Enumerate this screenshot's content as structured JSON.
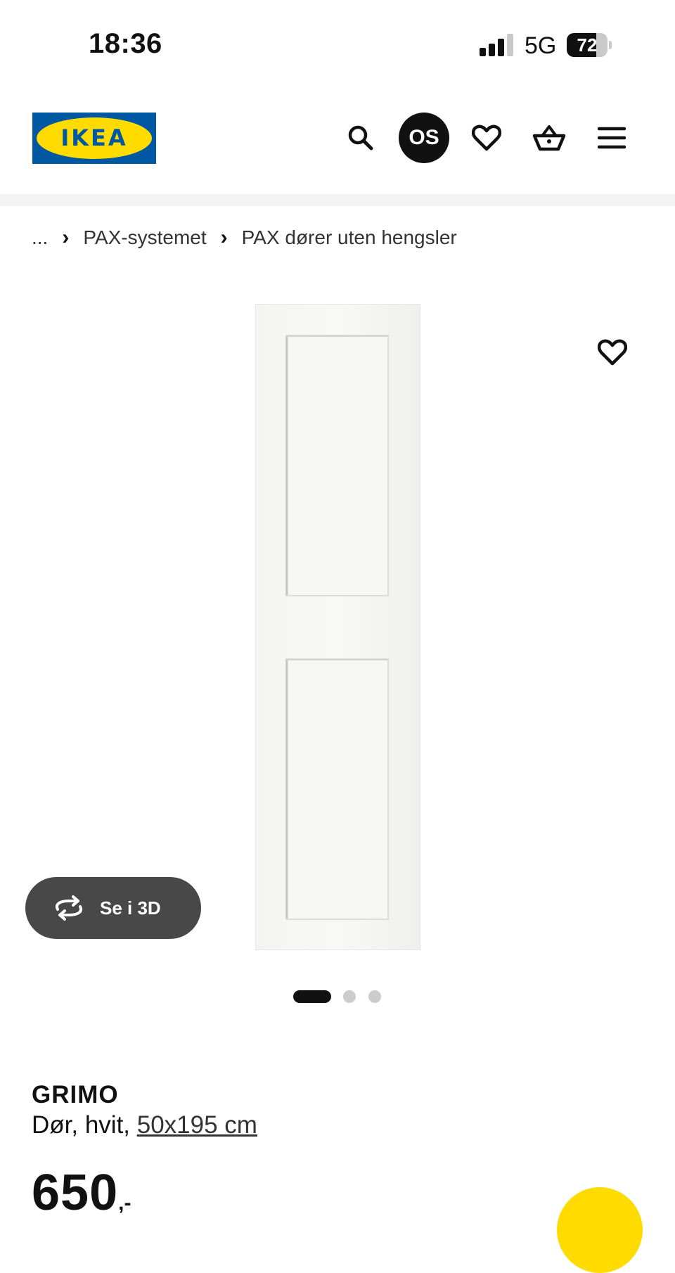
{
  "status_bar": {
    "time": "18:36",
    "network": "5G",
    "battery_level": "72",
    "battery_fraction": 0.72,
    "signal_bars_active": 3,
    "signal_bars_total": 4
  },
  "header": {
    "logo_text": "IKEA",
    "avatar_initials": "OS",
    "icons": [
      "search-icon",
      "heart-icon",
      "basket-icon",
      "menu-icon"
    ],
    "brand_colors": {
      "blue": "#0058a3",
      "yellow": "#ffdb00"
    }
  },
  "breadcrumb": {
    "ellipsis": "...",
    "items": [
      "PAX-systemet",
      "PAX dører uten hengsler"
    ]
  },
  "gallery": {
    "view_3d_label": "Se i 3D",
    "dots_total": 3,
    "dots_active": 1
  },
  "product": {
    "name": "GRIMO",
    "description_prefix": "Dør, hvit, ",
    "size": "50x195 cm",
    "price": "650",
    "price_suffix": ",-"
  }
}
